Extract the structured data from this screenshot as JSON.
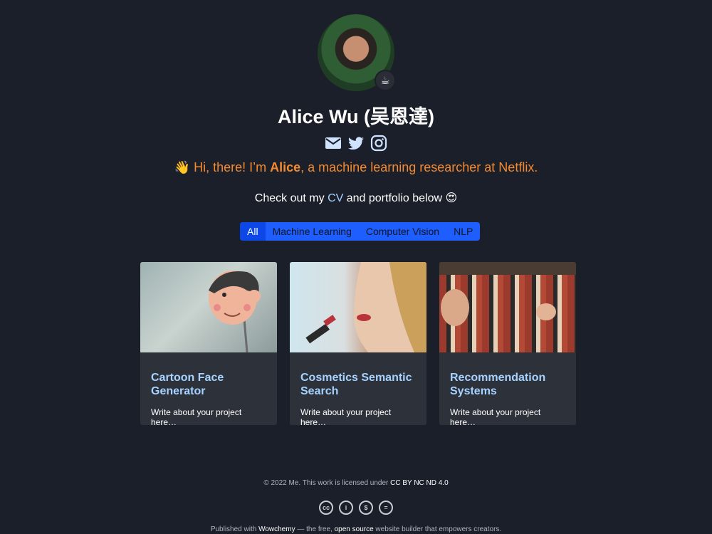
{
  "profile": {
    "name": "Alice Wu (吴恩達)",
    "avatar_badge": "☕"
  },
  "social": {
    "icons": [
      "envelope-icon",
      "twitter-icon",
      "instagram-icon"
    ]
  },
  "tagline": {
    "wave": "👋",
    "prefix": " Hi, there! I’m ",
    "name": "Alice",
    "suffix": ", a machine learning researcher at Netflix."
  },
  "cv_line": {
    "prefix": "Check out my ",
    "cv_link": "CV",
    "suffix": " and portfolio below 😍"
  },
  "filters": [
    {
      "label": "All",
      "active": true
    },
    {
      "label": "Machine Learning",
      "active": false
    },
    {
      "label": "Computer Vision",
      "active": false
    },
    {
      "label": "NLP",
      "active": false
    }
  ],
  "projects": [
    {
      "title": "Cartoon Face Generator",
      "summary": "Write about your project here…"
    },
    {
      "title": "Cosmetics Semantic Search",
      "summary": "Write about your project here…"
    },
    {
      "title": "Recommendation Systems",
      "summary": "Write about your project here…"
    }
  ],
  "footer": {
    "copy_prefix": "© 2022 Me. This work is licensed under ",
    "license_link": "CC BY NC ND 4.0",
    "cc_icons": [
      {
        "name": "cc-icon",
        "glyph": "cc"
      },
      {
        "name": "by-icon",
        "glyph": "i"
      },
      {
        "name": "nc-icon",
        "glyph": "$"
      },
      {
        "name": "nd-icon",
        "glyph": "="
      }
    ],
    "pub_prefix": "Published with ",
    "wowchemy_link": "Wowchemy",
    "pub_middle": " — the free, ",
    "open_source_link": "open source",
    "pub_suffix": " website builder that empowers creators."
  },
  "colors": {
    "background": "#1b1f2a",
    "accent_orange": "#f58a2e",
    "link_blue": "#a6d2ff",
    "filter_blue": "#1e5eff"
  }
}
